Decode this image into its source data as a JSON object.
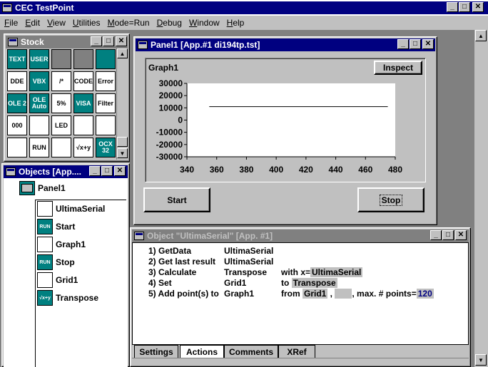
{
  "app": {
    "title": "CEC TestPoint"
  },
  "menu": [
    "File",
    "Edit",
    "View",
    "Utilities",
    "Mode=Run",
    "Debug",
    "Window",
    "Help"
  ],
  "stock": {
    "title": "Stock",
    "icons": [
      "TEXT",
      "USER",
      "",
      "",
      "",
      "DDE",
      "VBX",
      "/*",
      "CODE",
      "Error",
      "OLE 2",
      "OLE Auto",
      "5%",
      "VISA",
      "Filter",
      "000",
      "",
      "LED",
      "",
      "",
      "",
      "RUN",
      "",
      "√x+y",
      "OCX 32"
    ]
  },
  "objects": {
    "title": "Objects [App....",
    "root": "Panel1",
    "items": [
      {
        "label": "UltimaSerial",
        "icon": "serial-icon",
        "badge": ""
      },
      {
        "label": "Start",
        "icon": "run-icon",
        "badge": "RUN"
      },
      {
        "label": "Graph1",
        "icon": "graph-icon",
        "badge": ""
      },
      {
        "label": "Stop",
        "icon": "run-icon",
        "badge": "RUN"
      },
      {
        "label": "Grid1",
        "icon": "grid-icon",
        "badge": ""
      },
      {
        "label": "Transpose",
        "icon": "formula-icon",
        "badge": "√x+y"
      }
    ]
  },
  "panel": {
    "title": "Panel1 [App.#1 di194tp.tst]",
    "graph_label": "Graph1",
    "inspect": "Inspect",
    "start": "Start",
    "stop": "Stop"
  },
  "chart_data": {
    "type": "line",
    "title": "",
    "xlabel": "",
    "ylabel": "",
    "xlim": [
      340,
      480
    ],
    "ylim": [
      -30000,
      30000
    ],
    "x_ticks": [
      "340",
      "360",
      "380",
      "400",
      "420",
      "440",
      "460",
      "480"
    ],
    "y_ticks": [
      "30000",
      "20000",
      "10000",
      "0",
      "-10000",
      "-20000",
      "-30000"
    ],
    "series": [
      {
        "x": [
          355,
          475
        ],
        "y": [
          11000,
          11000
        ]
      }
    ]
  },
  "object_window": {
    "title": "Object \"UltimaSerial\" [App. #1]",
    "rows": [
      {
        "step": "1) GetData",
        "target": "UltimaSerial",
        "rest": []
      },
      {
        "step": "2) Get last result",
        "target": "UltimaSerial",
        "rest": []
      },
      {
        "step": "3) Calculate",
        "target": "Transpose",
        "rest": [
          {
            "t": "with x=",
            "k": "plain"
          },
          {
            "t": "UltimaSerial",
            "k": "hl"
          }
        ]
      },
      {
        "step": "4) Set",
        "target": "Grid1",
        "rest": [
          {
            "t": "to ",
            "k": "plain"
          },
          {
            "t": "Transpose",
            "k": "hl"
          }
        ]
      },
      {
        "step": "5) Add point(s) to",
        "target": "Graph1",
        "rest": [
          {
            "t": "from ",
            "k": "plain"
          },
          {
            "t": "Grid1",
            "k": "hl"
          },
          {
            "t": " , ",
            "k": "plain"
          },
          {
            "t": "      ",
            "k": "hl"
          },
          {
            "t": ", max. # points=",
            "k": "plain"
          },
          {
            "t": "120",
            "k": "hl2"
          }
        ]
      }
    ],
    "tabs": [
      "Settings",
      "Actions",
      "Comments",
      "XRef"
    ],
    "active_tab": "Actions"
  }
}
